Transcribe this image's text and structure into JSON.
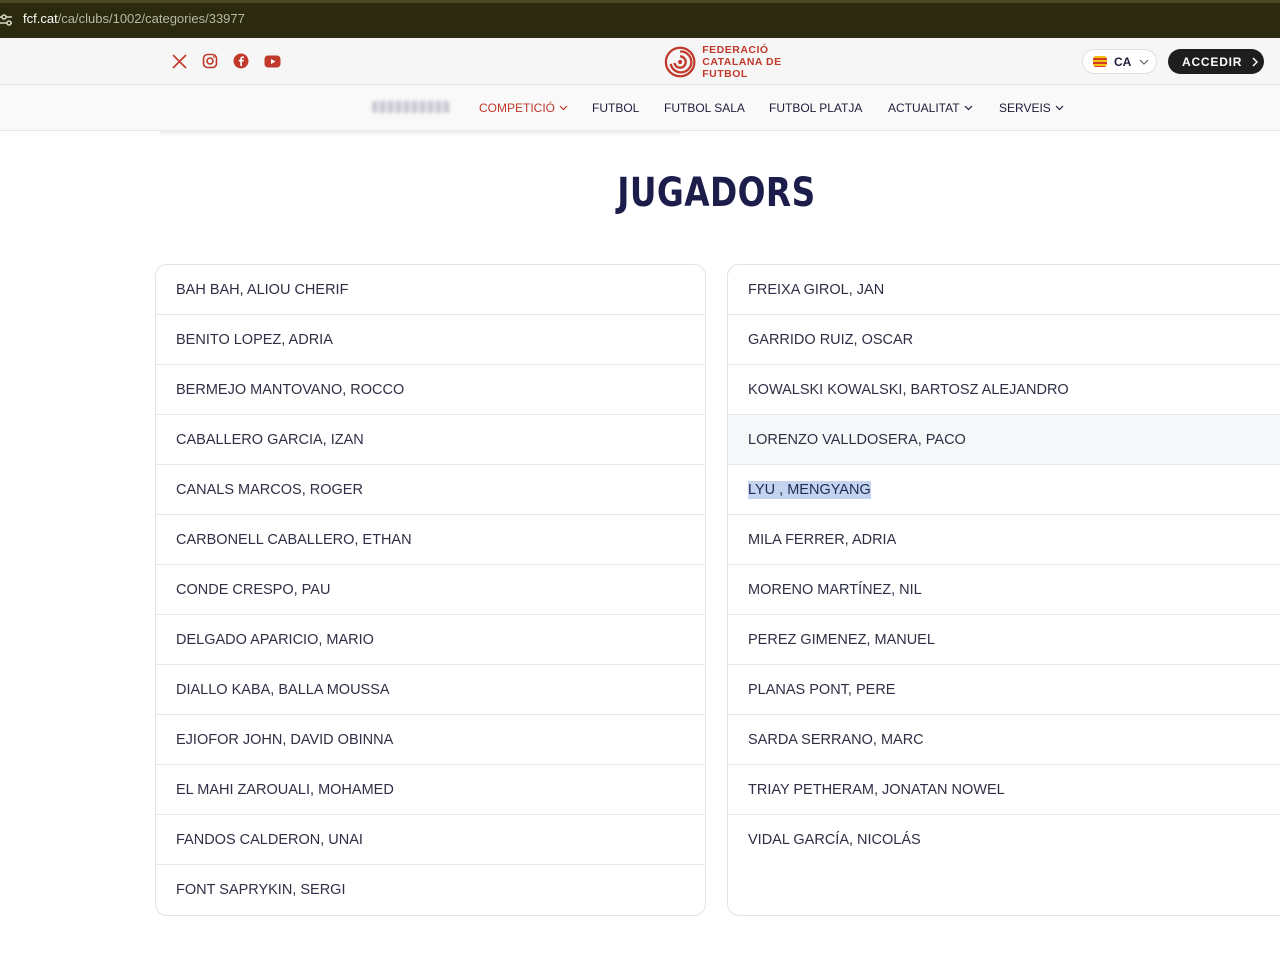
{
  "browser": {
    "url_host": "fcf.cat",
    "url_path": "/ca/clubs/1002/categories/33977"
  },
  "header": {
    "social": [
      "x-icon",
      "instagram-icon",
      "facebook-icon",
      "youtube-icon"
    ],
    "logo_line1": "FEDERACIÓ",
    "logo_line2": "CATALANA DE FUTBOL",
    "language": "CA",
    "access_label": "ACCEDIR"
  },
  "nav": {
    "items": [
      {
        "label": "COMPETICIÓ",
        "dropdown": true,
        "active": true
      },
      {
        "label": "FUTBOL",
        "dropdown": false
      },
      {
        "label": "FUTBOL SALA",
        "dropdown": false
      },
      {
        "label": "FUTBOL PLATJA",
        "dropdown": false
      },
      {
        "label": "ACTUALITAT",
        "dropdown": true
      },
      {
        "label": "SERVEIS",
        "dropdown": true
      }
    ]
  },
  "main": {
    "title": "JUGADORS",
    "players_left": [
      "BAH BAH, ALIOU CHERIF",
      "BENITO LOPEZ, ADRIA",
      "BERMEJO MANTOVANO, ROCCO",
      "CABALLERO GARCIA, IZAN",
      "CANALS MARCOS, ROGER",
      "CARBONELL CABALLERO, ETHAN",
      "CONDE CRESPO, PAU",
      "DELGADO APARICIO, MARIO",
      "DIALLO KABA, BALLA MOUSSA",
      "EJIOFOR JOHN, DAVID OBINNA",
      "EL MAHI ZAROUALI, MOHAMED",
      "FANDOS CALDERON, UNAI",
      "FONT SAPRYKIN, SERGI"
    ],
    "players_right": [
      "FREIXA GIROL, JAN",
      "GARRIDO RUIZ, OSCAR",
      "KOWALSKI KOWALSKI, BARTOSZ ALEJANDRO",
      "LORENZO VALLDOSERA, PACO",
      "LYU , MENGYANG",
      "MILA FERRER, ADRIA",
      "MORENO MARTÍNEZ, NIL",
      "PEREZ GIMENEZ, MANUEL",
      "PLANAS PONT, PERE",
      "SARDA SERRANO, MARC",
      "TRIAY PETHERAM, JONATAN NOWEL",
      "VIDAL GARCÍA, NICOLÁS"
    ],
    "hovered_right_index": 3,
    "selected_right_index": 4
  },
  "colors": {
    "accent_red": "#c0392b",
    "navy": "#1c1d4a",
    "selection": "#c5d4ee"
  }
}
